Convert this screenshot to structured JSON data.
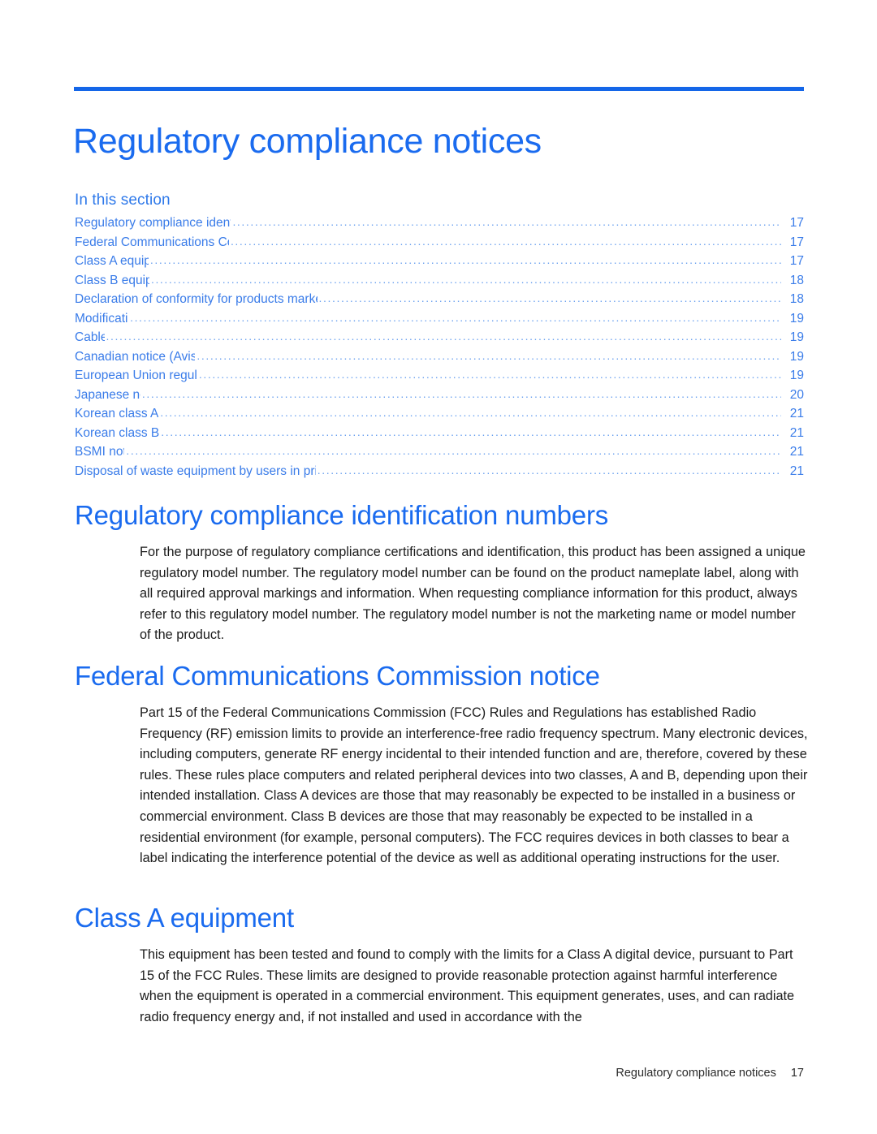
{
  "document": {
    "chapter_title": "Regulatory compliance notices",
    "accent_color": "#1a6bef",
    "toc_link_color": "#3a7ce9",
    "rule_color": "#1466e8"
  },
  "toc": {
    "heading": "In this section",
    "entries": [
      {
        "label": "Regulatory compliance identification numbers",
        "page": "17"
      },
      {
        "label": "Federal Communications Commission notice",
        "page": "17"
      },
      {
        "label": "Class A equipment",
        "page": "17"
      },
      {
        "label": "Class B equipment",
        "page": "18"
      },
      {
        "label": "Declaration of conformity for products marked with the FCC logo, United States only",
        "page": "18"
      },
      {
        "label": "Modifications",
        "page": "19"
      },
      {
        "label": "Cables",
        "page": "19"
      },
      {
        "label": "Canadian notice (Avis Canadien)",
        "page": "19"
      },
      {
        "label": "European Union regulatory notice",
        "page": "19"
      },
      {
        "label": "Japanese notice",
        "page": "20"
      },
      {
        "label": "Korean class A notice",
        "page": "21"
      },
      {
        "label": "Korean class B notice",
        "page": "21"
      },
      {
        "label": "BSMI notice",
        "page": "21"
      },
      {
        "label": "Disposal of waste equipment by users in private households in the European Union",
        "page": "21"
      }
    ],
    "dot_leader": "........................................................................................................................................................................................................"
  },
  "sections": [
    {
      "title": "Regulatory compliance identification numbers",
      "body": "For the purpose of regulatory compliance certifications and identification, this product has been assigned a unique regulatory model number. The regulatory model number can be found on the product nameplate label, along with all required approval markings and information. When requesting compliance information for this product, always refer to this regulatory model number. The regulatory model number is not the marketing name or model number of the product."
    },
    {
      "title": "Federal Communications Commission notice",
      "body": "Part 15 of the Federal Communications Commission (FCC) Rules and Regulations has established Radio Frequency (RF) emission limits to provide an interference-free radio frequency spectrum. Many electronic devices, including computers, generate RF energy incidental to their intended function and are, therefore, covered by these rules. These rules place computers and related peripheral devices into two classes, A and B, depending upon their intended installation. Class A devices are those that may reasonably be expected to be installed in a business or commercial environment. Class B devices are those that may reasonably be expected to be installed in a residential environment (for example, personal computers). The FCC requires devices in both classes to bear a label indicating the interference potential of the device as well as additional operating instructions for the user."
    },
    {
      "title": "Class A equipment",
      "body": "This equipment has been tested and found to comply with the limits for a Class A digital device, pursuant to Part 15 of the FCC Rules. These limits are designed to provide reasonable protection against harmful interference when the equipment is operated in a commercial environment. This equipment generates, uses, and can radiate radio frequency energy and, if not installed and used in accordance with the"
    }
  ],
  "footer": {
    "title": "Regulatory compliance notices",
    "page_number": "17"
  }
}
